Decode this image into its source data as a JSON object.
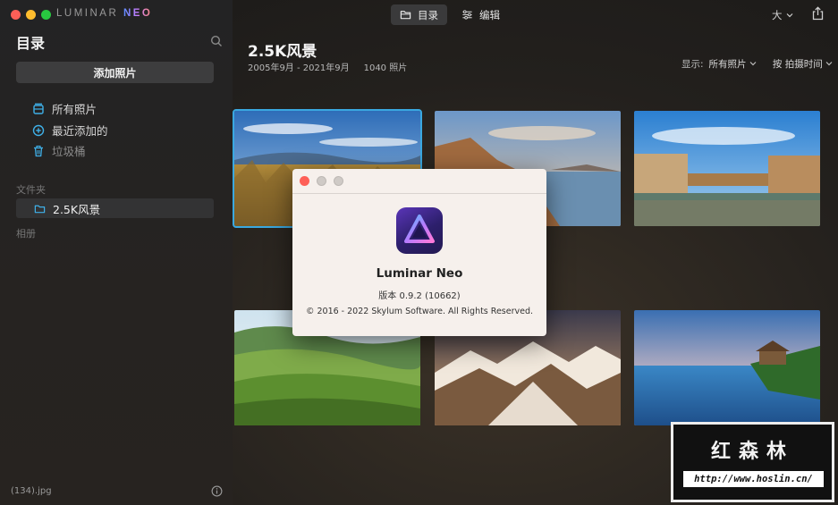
{
  "window": {
    "brand_main": "LUMINAR ",
    "brand_accent": "NEO"
  },
  "sidebar": {
    "title": "目录",
    "add_button": "添加照片",
    "items": [
      {
        "label": "所有照片",
        "icon": "photo-stack-icon"
      },
      {
        "label": "最近添加的",
        "icon": "plus-circle-icon"
      },
      {
        "label": "垃圾桶",
        "icon": "trash-icon"
      }
    ],
    "folders_label": "文件夹",
    "folder": "2.5K风景",
    "albums_label": "相册",
    "bottom_file": "(134).jpg"
  },
  "topbar": {
    "tabs": [
      {
        "label": "目录",
        "icon": "folder-icon",
        "active": true
      },
      {
        "label": "编辑",
        "icon": "sliders-icon",
        "active": false
      }
    ],
    "size": "大"
  },
  "main": {
    "title": "2.5K风景",
    "date_range": "2005年9月 - 2021年9月",
    "count": "1040 照片",
    "display_label": "显示:",
    "display_value": "所有照片",
    "sort_value": "按 拍摄时间"
  },
  "dialog": {
    "app_name": "Luminar Neo",
    "version": "版本 0.9.2 (10662)",
    "copyright": "© 2016 - 2022 Skylum Software. All Rights Reserved."
  },
  "watermark": {
    "title": "红森林",
    "url": "http://www.hoslin.cn/"
  },
  "colors": {
    "accent_selection": "#3aa8e0",
    "sidebar_bg": "#242324",
    "dialog_bg": "#f6f0ec"
  }
}
